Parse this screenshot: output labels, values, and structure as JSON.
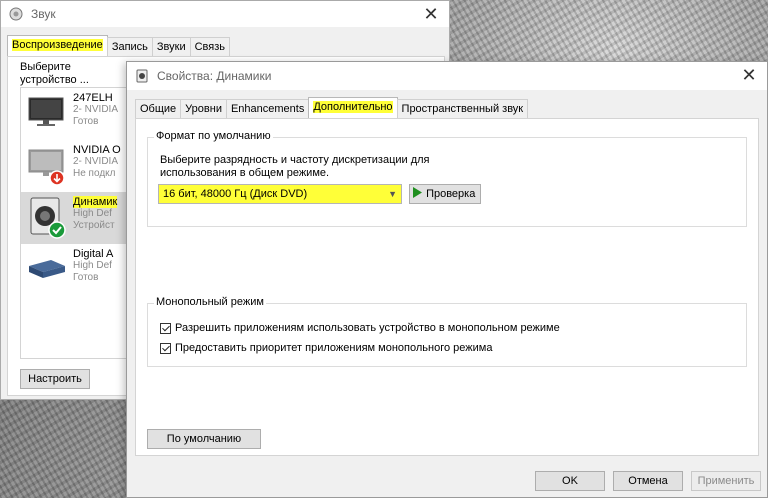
{
  "back_window": {
    "title": "Звук",
    "tabs": [
      {
        "label": "Воспроизведение"
      },
      {
        "label": "Запись"
      },
      {
        "label": "Звуки"
      },
      {
        "label": "Связь"
      }
    ],
    "instruction": "Выберите устройство ... изменить:",
    "devices": [
      {
        "name": "247ELH",
        "line2": "2- NVIDIA",
        "line3": "Готов"
      },
      {
        "name": "NVIDIA O",
        "line2": "2- NVIDIA",
        "line3": "Не подкл"
      },
      {
        "name": "Динамик",
        "line2": "High Def",
        "line3": "Устройст"
      },
      {
        "name": "Digital A",
        "line2": "High Def",
        "line3": "Готов"
      }
    ],
    "configure_button": "Настроить"
  },
  "front_window": {
    "title": "Свойства: Динамики",
    "tabs": [
      {
        "label": "Общие"
      },
      {
        "label": "Уровни"
      },
      {
        "label": "Enhancements"
      },
      {
        "label": "Дополнительно"
      },
      {
        "label": "Пространственный звук"
      }
    ],
    "format_group": {
      "title": "Формат по умолчанию",
      "description": "Выберите разрядность и частоту дискретизации для использования в общем режиме.",
      "selected_format": "16 бит, 48000 Гц (Диск DVD)",
      "test_button": "Проверка"
    },
    "exclusive_group": {
      "title": "Монопольный режим",
      "options": [
        {
          "label": "Разрешить приложениям использовать устройство в монопольном режиме",
          "checked": true
        },
        {
          "label": "Предоставить приоритет приложениям монопольного режима",
          "checked": true
        }
      ]
    },
    "defaults_button": "По умолчанию",
    "ok_button": "OK",
    "cancel_button": "Отмена",
    "apply_button": "Применить"
  },
  "colors": {
    "highlight": "#ffff38",
    "play_green": "#1f8f1f",
    "check_green": "#1a9a3a"
  }
}
